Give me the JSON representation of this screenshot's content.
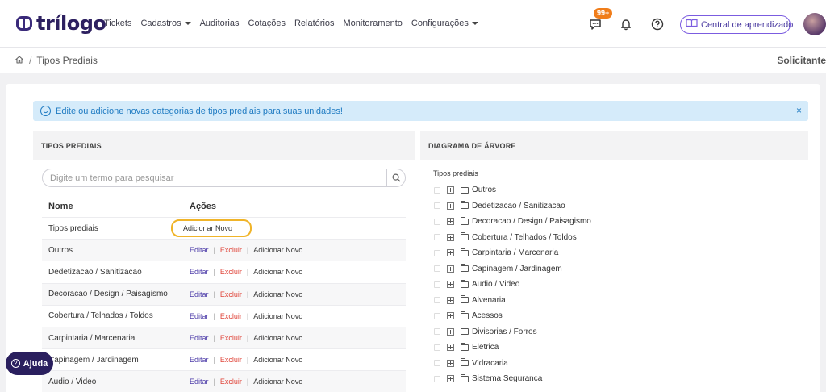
{
  "header": {
    "logo_text": "trílogo",
    "nav": [
      {
        "label": "Tickets",
        "dropdown": false
      },
      {
        "label": "Cadastros",
        "dropdown": true
      },
      {
        "label": "Auditorias",
        "dropdown": false
      },
      {
        "label": "Cotações",
        "dropdown": false
      },
      {
        "label": "Relatórios",
        "dropdown": false
      },
      {
        "label": "Monitoramento",
        "dropdown": false
      },
      {
        "label": "Configurações",
        "dropdown": true
      }
    ],
    "chat_badge": "99+",
    "learning_button": "Central de aprendizado",
    "accent_color": "#7b5ce0",
    "brand_color": "#2d2060"
  },
  "breadcrumb": {
    "home_icon": "home-icon",
    "current": "Tipos Prediais",
    "right_label": "Solicitante"
  },
  "alert": {
    "text": "Edite ou adicione novas categorias de tipos prediais para suas unidades!",
    "close": "×"
  },
  "left_panel": {
    "title": "TIPOS PREDIAIS",
    "search_placeholder": "Digite um termo para pesquisar",
    "columns": {
      "name": "Nome",
      "actions": "Ações"
    },
    "root_row": {
      "name": "Tipos prediais",
      "add": "Adicionar Novo"
    },
    "actions": {
      "edit": "Editar",
      "delete": "Excluir",
      "add": "Adicionar Novo"
    },
    "rows": [
      "Outros",
      "Dedetizacao / Sanitizacao",
      "Decoracao / Design / Paisagismo",
      "Cobertura / Telhados / Toldos",
      "Carpintaria / Marcenaria",
      "Capinagem / Jardinagem",
      "Audio / Video"
    ]
  },
  "right_panel": {
    "title": "DIAGRAMA DE ÁRVORE",
    "root": "Tipos prediais",
    "items": [
      "Outros",
      "Dedetizacao / Sanitizacao",
      "Decoracao / Design / Paisagismo",
      "Cobertura / Telhados / Toldos",
      "Carpintaria / Marcenaria",
      "Capinagem / Jardinagem",
      "Audio / Video",
      "Alvenaria",
      "Acessos",
      "Divisorias / Forros",
      "Eletrica",
      "Vidracaria",
      "Sistema Seguranca"
    ]
  },
  "help": {
    "label": "Ajuda"
  }
}
